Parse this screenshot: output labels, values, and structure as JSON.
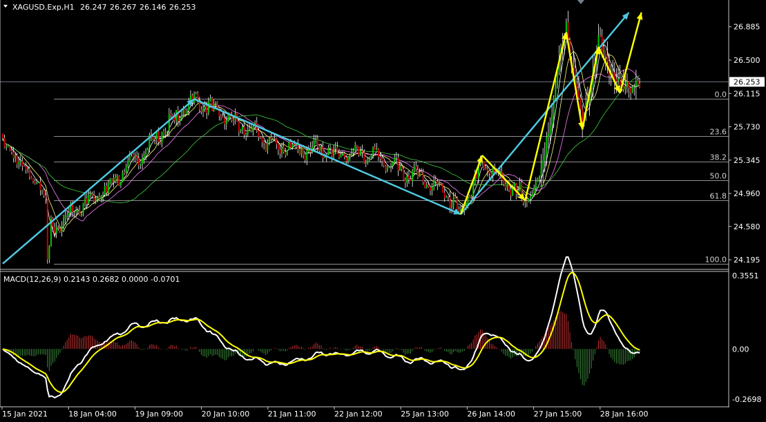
{
  "chart_data": {
    "type": "candlestick",
    "header": {
      "symbol": "XAGUSD.Exp,H1",
      "open": "26.247",
      "high": "26.267",
      "low": "26.146",
      "close": "26.253"
    },
    "price_axis": {
      "ylim": [
        24.1,
        27.05
      ],
      "ticks": [
        "26.885",
        "26.500",
        "26.115",
        "25.730",
        "25.345",
        "24.960",
        "24.580",
        "24.195"
      ],
      "current_price": "26.253"
    },
    "time_axis": {
      "labels": [
        "15 Jan 2021",
        "18 Jan 04:00",
        "19 Jan 09:00",
        "20 Jan 10:00",
        "21 Jan 11:00",
        "22 Jan 12:00",
        "25 Jan 13:00",
        "26 Jan 14:00",
        "27 Jan 15:00",
        "28 Jan 16:00"
      ]
    },
    "fibonacci": {
      "levels": [
        {
          "label": "0.0",
          "price": 26.05
        },
        {
          "label": "23.6",
          "price": 25.62
        },
        {
          "label": "38.2",
          "price": 25.33
        },
        {
          "label": "50.0",
          "price": 25.11
        },
        {
          "label": "61.8",
          "price": 24.88
        },
        {
          "label": "100.0",
          "price": 24.15
        }
      ]
    },
    "key_path": [
      {
        "t": 0,
        "p": 24.15
      },
      {
        "t": 57,
        "p": 25.0
      },
      {
        "t": 107,
        "p": 26.05
      },
      {
        "t": 153,
        "p": 25.5
      },
      {
        "t": 208,
        "p": 25.4
      },
      {
        "t": 245,
        "p": 25.0
      },
      {
        "t": 256,
        "p": 24.72
      },
      {
        "t": 268,
        "p": 25.3
      },
      {
        "t": 292,
        "p": 24.9
      },
      {
        "t": 300,
        "p": 25.1
      },
      {
        "t": 315,
        "p": 26.9
      },
      {
        "t": 324,
        "p": 25.75
      },
      {
        "t": 333,
        "p": 26.7
      },
      {
        "t": 345,
        "p": 26.15
      },
      {
        "t": 352,
        "p": 26.25
      }
    ],
    "macd": {
      "label": "MACD(12,26,9) 0.2143 0.2682 0.0000 -0.0701",
      "ylim": [
        -0.269,
        0.3551
      ],
      "ticks": [
        "0.3551",
        "0.00",
        "-0.2698"
      ]
    },
    "colors": {
      "background": "#000000",
      "bull_candle": "#00c800",
      "bear_candle": "#c80000",
      "wick": "#ffffff",
      "fib_line": "#bfbfbf",
      "trend_arrow": "#4fc8e0",
      "wave_arrow": "#ffff00",
      "ma_fast": "#ffffff",
      "ma_mid": "#ffff80",
      "ma_slow": "#ff80ff",
      "ma_long": "#40d040",
      "macd_line": "#ffffff",
      "signal_line": "#ffff00",
      "hist_pos": "#c83030",
      "hist_neg": "#3a8a3a"
    }
  }
}
